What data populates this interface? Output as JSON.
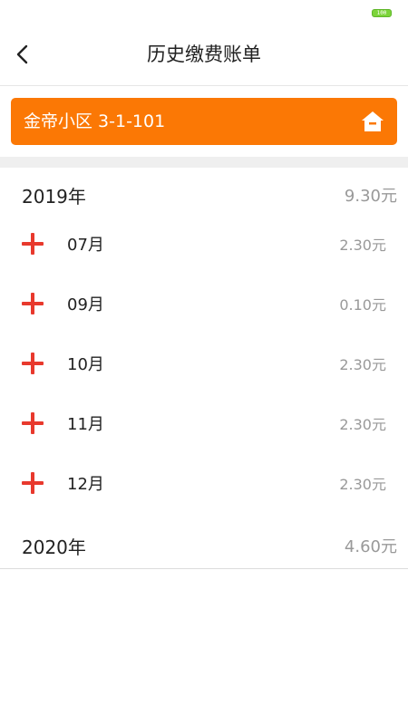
{
  "status_bar": {
    "battery": "100"
  },
  "header": {
    "back_icon": "chevron-left-icon",
    "title": "历史缴费账单"
  },
  "community": {
    "name": "金帝小区 3-1-101",
    "icon": "home-icon",
    "background_color": "#fb7805"
  },
  "years": [
    {
      "label": "2019年",
      "total": "9.30元",
      "expanded": true,
      "months": [
        {
          "label": "07月",
          "amount": "2.30元"
        },
        {
          "label": "09月",
          "amount": "0.10元"
        },
        {
          "label": "10月",
          "amount": "2.30元"
        },
        {
          "label": "11月",
          "amount": "2.30元"
        },
        {
          "label": "12月",
          "amount": "2.30元"
        }
      ]
    },
    {
      "label": "2020年",
      "total": "4.60元",
      "expanded": false,
      "months": []
    }
  ],
  "colors": {
    "accent_orange": "#fb7805",
    "plus_red": "#e8392d",
    "amount_gray": "#999999"
  }
}
